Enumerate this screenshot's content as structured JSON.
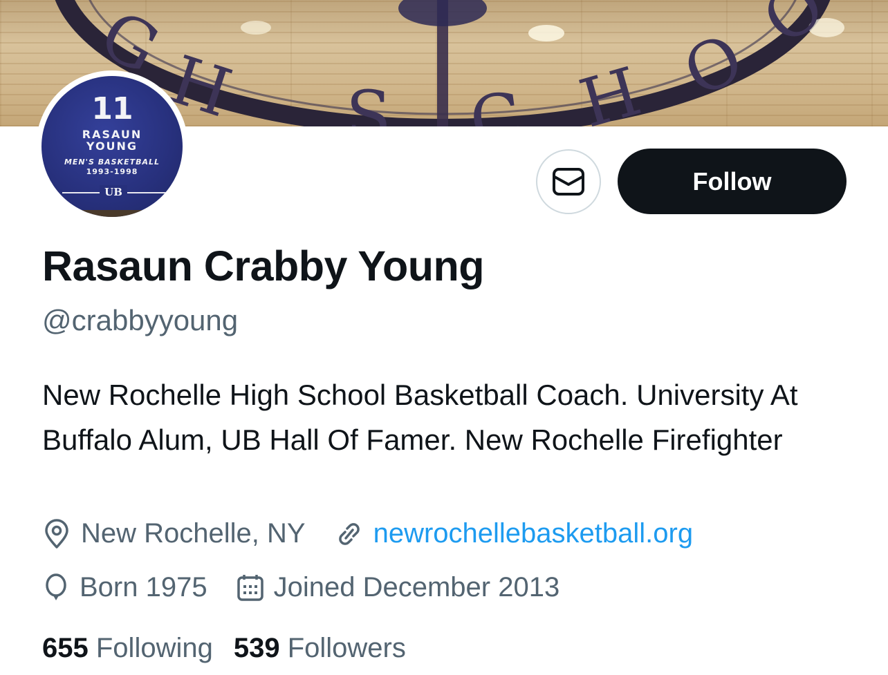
{
  "banner": {
    "floor_lettering": "HIGH SCHOOL"
  },
  "avatar": {
    "number": "11",
    "name_line1": "RASAUN",
    "name_line2": "YOUNG",
    "sport": "MEN'S BASKETBALL",
    "years": "1993-1998",
    "logo_text": "UB"
  },
  "actions": {
    "message_icon": "mail-icon",
    "follow_label": "Follow"
  },
  "profile": {
    "display_name": "Rasaun Crabby Young",
    "handle": "@crabbyyoung",
    "bio": "New Rochelle High School Basketball Coach. University At Buffalo Alum, UB Hall Of Famer. New Rochelle Firefighter",
    "location": "New Rochelle, NY",
    "website": "newrochellebasketball.org",
    "birth": "Born 1975",
    "joined": "Joined December 2013"
  },
  "stats": {
    "following_count": "655",
    "following_label": "Following",
    "followers_count": "539",
    "followers_label": "Followers"
  },
  "icons": {
    "location": "location-pin-icon",
    "website": "link-icon",
    "birth": "balloon-icon",
    "joined": "calendar-icon"
  },
  "colors": {
    "link": "#1d9bf0",
    "secondary_text": "#536471",
    "primary_text": "#0f1419",
    "follow_button": "#0f1419"
  }
}
